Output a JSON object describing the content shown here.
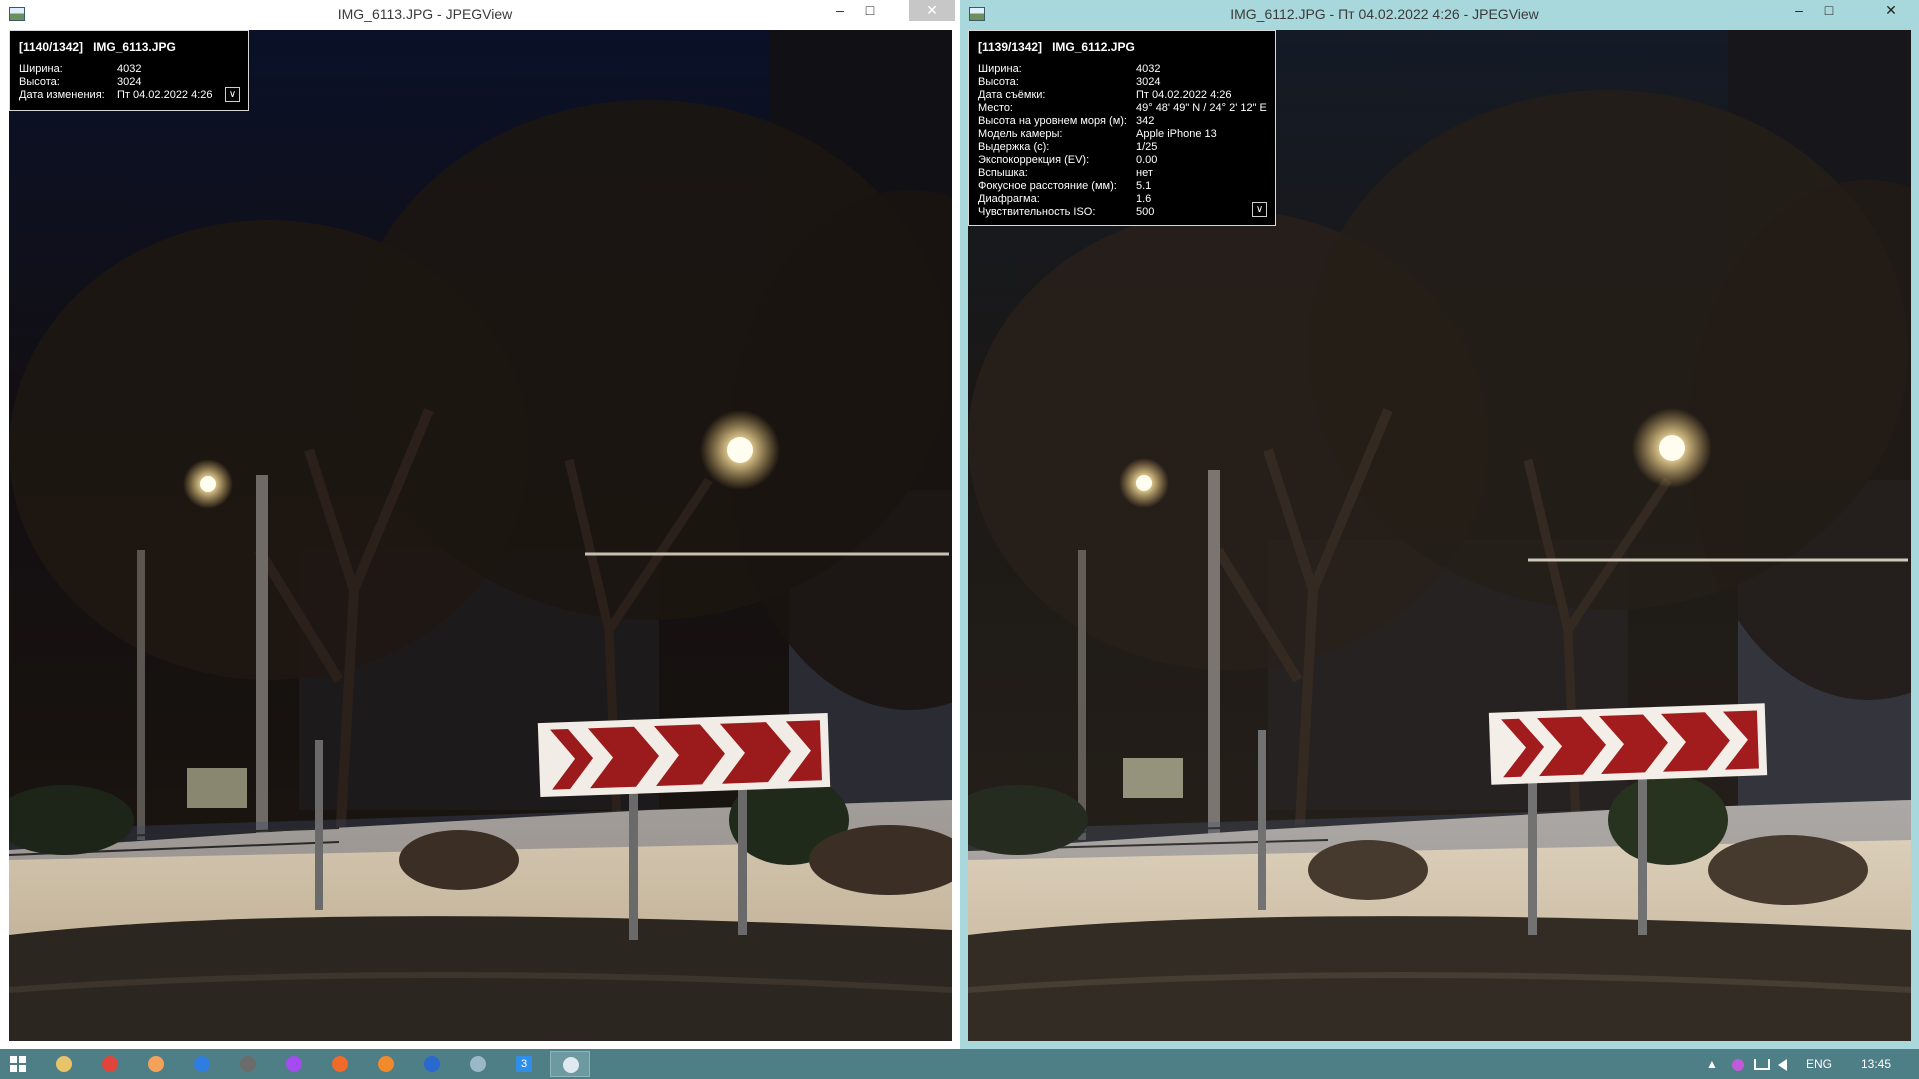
{
  "left_window": {
    "title": "IMG_6113.JPG - JPEGView",
    "info": {
      "index": "[1140/1342]",
      "filename": "IMG_6113.JPG",
      "rows": [
        {
          "label": "Ширина:",
          "value": "4032"
        },
        {
          "label": "Высота:",
          "value": "3024"
        },
        {
          "label": "Дата изменения:",
          "value": "Пт 04.02.2022 4:26"
        }
      ]
    }
  },
  "right_window": {
    "title": "IMG_6112.JPG - Пт 04.02.2022 4:26 - JPEGView",
    "info": {
      "index": "[1139/1342]",
      "filename": "IMG_6112.JPG",
      "rows": [
        {
          "label": "Ширина:",
          "value": "4032"
        },
        {
          "label": "Высота:",
          "value": "3024"
        },
        {
          "label": "Дата съёмки:",
          "value": "Пт 04.02.2022 4:26"
        },
        {
          "label": "Место:",
          "value": "49° 48' 49\" N / 24° 2' 12\" E"
        },
        {
          "label": "Высота на уровнем моря (м):",
          "value": "342"
        },
        {
          "label": "Модель камеры:",
          "value": "Apple iPhone 13"
        },
        {
          "label": "Выдержка (с):",
          "value": "1/25"
        },
        {
          "label": "Экспокоррекция (EV):",
          "value": "0.00"
        },
        {
          "label": "Вспышка:",
          "value": "нет"
        },
        {
          "label": "Фокусное расстояние (мм):",
          "value": "5.1"
        },
        {
          "label": "Диафрагма:",
          "value": "1.6"
        },
        {
          "label": "Чувствительность ISO:",
          "value": "500"
        }
      ]
    }
  },
  "window_controls": {
    "minimize": "–",
    "maximize": "□",
    "close": "✕",
    "expand": "∨"
  },
  "taskbar": {
    "apps": [
      {
        "name": "file-explorer",
        "color": "#e9c46a"
      },
      {
        "name": "chrome",
        "color": "#e0443a"
      },
      {
        "name": "app-colorful",
        "color": "#f4a259"
      },
      {
        "name": "tasks",
        "color": "#2f7de1"
      },
      {
        "name": "app-grey",
        "color": "#6b6b6b"
      },
      {
        "name": "messenger",
        "color": "#a24cf0"
      },
      {
        "name": "app-orange",
        "color": "#f06a2a"
      },
      {
        "name": "app-orange-2",
        "color": "#f08a2a"
      },
      {
        "name": "app-blue",
        "color": "#2a6ad0"
      },
      {
        "name": "app-photo",
        "color": "#9ab8c8"
      },
      {
        "name": "app-number",
        "color": "#2f8ee8",
        "text": "3"
      },
      {
        "name": "jpegview",
        "color": "#dfe9ef",
        "active": true
      }
    ],
    "tray": {
      "caret": "▲",
      "language": "ENG",
      "time": "13:45"
    }
  }
}
